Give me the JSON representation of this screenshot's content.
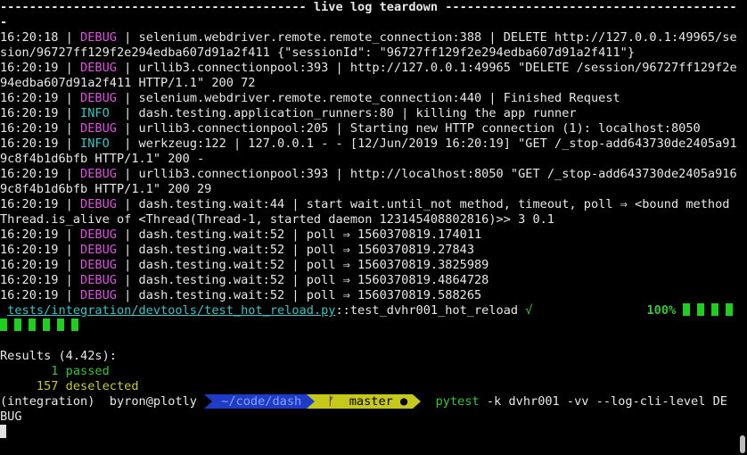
{
  "header": {
    "left_dashes": "------------------------------------------ ",
    "title": "live log teardown",
    "right_dashes": " ------------------------------------------",
    "wrap": "-"
  },
  "logs": [
    {
      "time": "16:20:18",
      "level": "DEBUG",
      "msg": "selenium.webdriver.remote.remote_connection:388 | DELETE http://127.0.0.1:49965/ses",
      "cont": "sion/96727ff129f2e294edba607d91a2f411 {\"sessionId\": \"96727ff129f2e294edba607d91a2f411\"}"
    },
    {
      "time": "16:20:19",
      "level": "DEBUG",
      "msg": "urllib3.connectionpool:393 | http://127.0.0.1:49965 \"DELETE /session/96727ff129f2e2",
      "cont": "94edba607d91a2f411 HTTP/1.1\" 200 72"
    },
    {
      "time": "16:20:19",
      "level": "DEBUG",
      "msg": "selenium.webdriver.remote.remote_connection:440 | Finished Request",
      "cont": ""
    },
    {
      "time": "16:20:19",
      "level": "INFO",
      "msg": "dash.testing.application_runners:80 | killing the app runner",
      "cont": ""
    },
    {
      "time": "16:20:19",
      "level": "DEBUG",
      "msg": "urllib3.connectionpool:205 | Starting new HTTP connection (1): localhost:8050",
      "cont": ""
    },
    {
      "time": "16:20:19",
      "level": "INFO",
      "msg": "werkzeug:122 | 127.0.0.1 - - [12/Jun/2019 16:20:19] \"GET /_stop-add643730de2405a916c",
      "cont": "9c8f4b1d6bfb HTTP/1.1\" 200 -"
    },
    {
      "time": "16:20:19",
      "level": "DEBUG",
      "msg": "urllib3.connectionpool:393 | http://localhost:8050 \"GET /_stop-add643730de2405a916c",
      "cont": "9c8f4b1d6bfb HTTP/1.1\" 200 29"
    },
    {
      "time": "16:20:19",
      "level": "DEBUG",
      "msg": "dash.testing.wait:44 | start wait.until_not method, timeout, poll ⇒ <bound method",
      "cont": "Thread.is_alive of <Thread(Thread-1, started daemon 123145408802816)>> 3 0.1"
    },
    {
      "time": "16:20:19",
      "level": "DEBUG",
      "msg": "dash.testing.wait:52 | poll ⇒ 1560370819.174011",
      "cont": ""
    },
    {
      "time": "16:20:19",
      "level": "DEBUG",
      "msg": "dash.testing.wait:52 | poll ⇒ 1560370819.27843",
      "cont": ""
    },
    {
      "time": "16:20:19",
      "level": "DEBUG",
      "msg": "dash.testing.wait:52 | poll ⇒ 1560370819.3825989",
      "cont": ""
    },
    {
      "time": "16:20:19",
      "level": "DEBUG",
      "msg": "dash.testing.wait:52 | poll ⇒ 1560370819.4864728",
      "cont": ""
    },
    {
      "time": "16:20:19",
      "level": "DEBUG",
      "msg": "dash.testing.wait:52 | poll ⇒ 1560370819.588265",
      "cont": ""
    }
  ],
  "test": {
    "path": "tests/integration/devtools/test_hot_reload.py",
    "sep": "::",
    "name": "test_dvhr001_hot_reload",
    "check": " √",
    "percent": "100%"
  },
  "results": {
    "heading": "Results (4.42s):",
    "passed": "       1 passed",
    "deselected": "     157 deselected"
  },
  "prompt": {
    "env": "(integration)",
    "user": "byron@plotly",
    "dir": "~/code/dash",
    "branch_icon": "ᚠ",
    "branch": "master ●",
    "cmd": "pytest",
    "args": " -k dvhr001 -vv --log-cli-level DE",
    "args_wrap": "BUG"
  },
  "colors": {
    "debug": "#d957d9",
    "info": "#3fc2c2",
    "green": "#3cc33c",
    "blue_seg": "#1e3cc8",
    "yellow_seg": "#c6c81a"
  }
}
